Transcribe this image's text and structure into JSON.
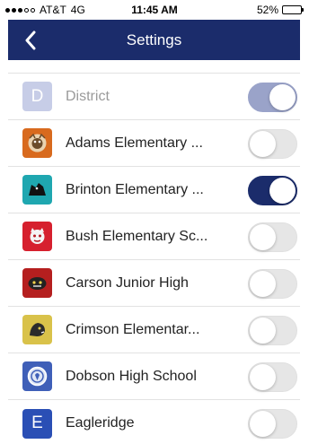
{
  "status_bar": {
    "carrier": "AT&T",
    "network": "4G",
    "time": "11:45 AM",
    "battery": "52%",
    "battery_level": 0.52
  },
  "nav": {
    "title": "Settings",
    "back_icon": "chevron-left-icon"
  },
  "colors": {
    "nav_bg": "#1b2c6b",
    "toggle_on": "#1b2c6b",
    "toggle_on_disabled": "#9aa3c9",
    "toggle_off": "#e6e6e6"
  },
  "schools": [
    {
      "key": "district",
      "label": "District",
      "logo_letter": "D",
      "logo_color": "#9ba6d4",
      "enabled": true,
      "disabled": true
    },
    {
      "key": "adams",
      "label": "Adams Elementary ...",
      "logo_color": "#d86a1e",
      "logo_icon": "mascot-icon",
      "enabled": false
    },
    {
      "key": "brinton",
      "label": "Brinton Elementary ...",
      "logo_color": "#1fa7b0",
      "logo_icon": "mascot-icon",
      "enabled": true
    },
    {
      "key": "bush",
      "label": "Bush Elementary Sc...",
      "logo_color": "#d6202e",
      "logo_icon": "mascot-icon",
      "enabled": false
    },
    {
      "key": "carson",
      "label": "Carson Junior High",
      "logo_color": "#b51f1f",
      "logo_icon": "mascot-icon",
      "enabled": false
    },
    {
      "key": "crimson",
      "label": "Crimson Elementar...",
      "logo_color": "#d9c24a",
      "logo_icon": "mascot-icon",
      "enabled": false
    },
    {
      "key": "dobson",
      "label": "Dobson High School",
      "logo_color": "#3f5fb8",
      "logo_icon": "mascot-icon",
      "enabled": false
    },
    {
      "key": "eagleridge",
      "label": "Eagleridge",
      "logo_letter": "E",
      "logo_color": "#2a4fb5",
      "enabled": false
    }
  ]
}
